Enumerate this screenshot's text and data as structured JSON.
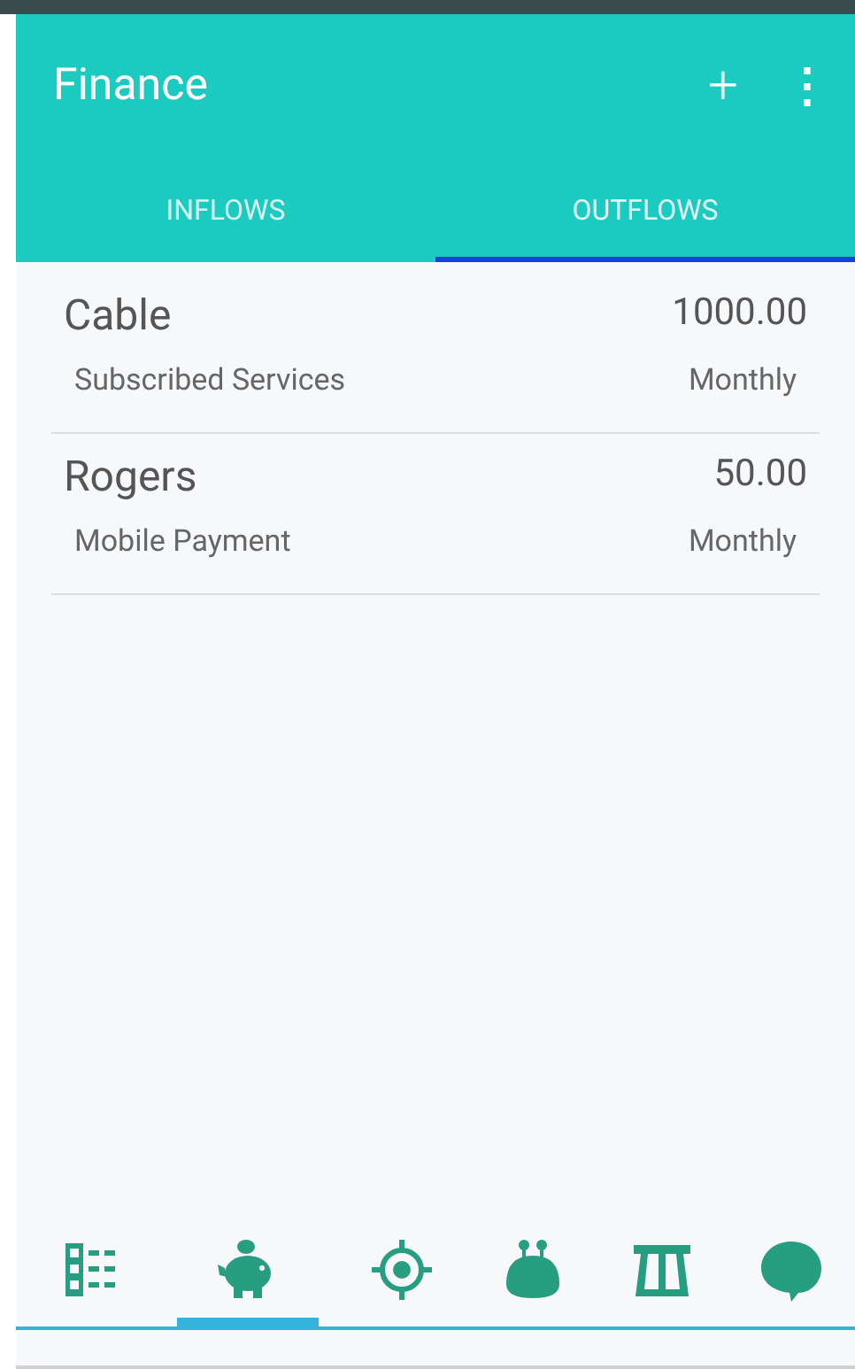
{
  "app_bar": {
    "title": "Finance",
    "actions": [
      "+",
      "⋮"
    ]
  },
  "tabs": [
    {
      "label": "INFLOWS",
      "selected": false
    },
    {
      "label": "OUTFLOWS",
      "selected": true
    }
  ],
  "items": [
    {
      "name": "Cable",
      "amount": "1000.00",
      "category": "Subscribed Services",
      "frequency": "Monthly"
    },
    {
      "name": "Rogers",
      "amount": "50.00",
      "category": "Mobile Payment",
      "frequency": "Monthly"
    }
  ],
  "bottom_nav": [
    {
      "kind": "list",
      "selected": false
    },
    {
      "kind": "piggy",
      "selected": true
    },
    {
      "kind": "target",
      "selected": false
    },
    {
      "kind": "purse",
      "selected": false
    },
    {
      "kind": "road",
      "selected": false
    },
    {
      "kind": "chat",
      "selected": false
    }
  ]
}
